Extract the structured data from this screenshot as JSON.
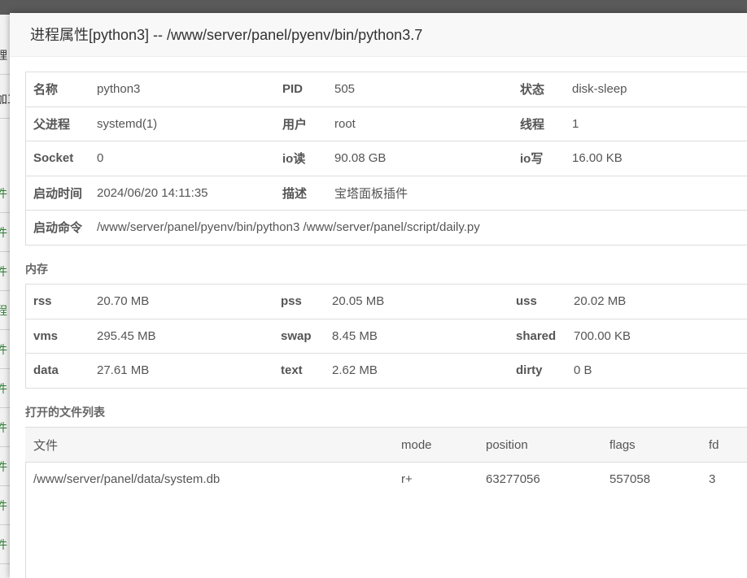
{
  "background": {
    "rows": [
      {
        "text": "理",
        "tone": "dark"
      },
      {
        "text": "加工",
        "tone": "dark"
      },
      {
        "text": "件",
        "tone": "green"
      },
      {
        "text": "件",
        "tone": "green"
      },
      {
        "text": "件",
        "tone": "green"
      },
      {
        "text": "程",
        "tone": "green"
      },
      {
        "text": "件",
        "tone": "green"
      },
      {
        "text": "件",
        "tone": "green"
      },
      {
        "text": "件",
        "tone": "green"
      },
      {
        "text": "件",
        "tone": "green"
      },
      {
        "text": "件",
        "tone": "green"
      },
      {
        "text": "件",
        "tone": "green"
      }
    ]
  },
  "modal": {
    "title": "进程属性[python3] -- /www/server/panel/pyenv/bin/python3.7"
  },
  "process": {
    "name_label": "名称",
    "name": "python3",
    "pid_label": "PID",
    "pid": "505",
    "status_label": "状态",
    "status": "disk-sleep",
    "parent_label": "父进程",
    "parent": "systemd(1)",
    "user_label": "用户",
    "user": "root",
    "threads_label": "线程",
    "threads": "1",
    "socket_label": "Socket",
    "socket": "0",
    "io_read_label": "io读",
    "io_read": "90.08 GB",
    "io_write_label": "io写",
    "io_write": "16.00 KB",
    "start_time_label": "启动时间",
    "start_time": "2024/06/20 14:11:35",
    "desc_label": "描述",
    "desc": "宝塔面板插件",
    "cmd_label": "启动命令",
    "cmd": "/www/server/panel/pyenv/bin/python3 /www/server/panel/script/daily.py"
  },
  "memory": {
    "section_title": "内存",
    "rss_label": "rss",
    "rss": "20.70 MB",
    "pss_label": "pss",
    "pss": "20.05 MB",
    "uss_label": "uss",
    "uss": "20.02 MB",
    "vms_label": "vms",
    "vms": "295.45 MB",
    "swap_label": "swap",
    "swap": "8.45 MB",
    "shared_label": "shared",
    "shared": "700.00 KB",
    "data_label": "data",
    "data": "27.61 MB",
    "text_label": "text",
    "text": "2.62 MB",
    "dirty_label": "dirty",
    "dirty": "0 B"
  },
  "files": {
    "section_title": "打开的文件列表",
    "headers": {
      "file": "文件",
      "mode": "mode",
      "position": "position",
      "flags": "flags",
      "fd": "fd"
    },
    "rows": [
      {
        "file": "/www/server/panel/data/system.db",
        "mode": "r+",
        "position": "63277056",
        "flags": "557058",
        "fd": "3"
      }
    ]
  }
}
